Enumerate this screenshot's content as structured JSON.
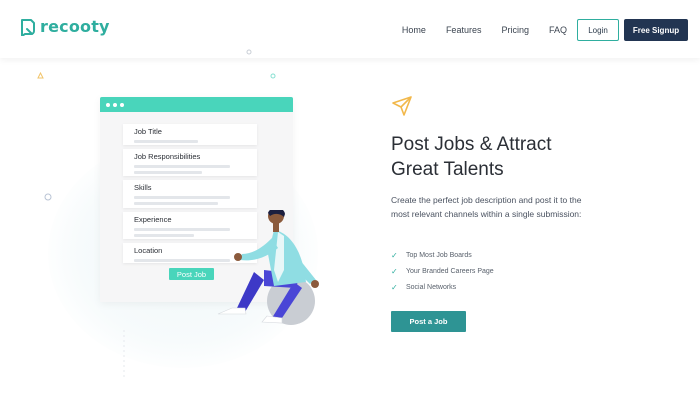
{
  "brand": {
    "name": "recooty",
    "accent": "#2fae9f",
    "dark": "#223552"
  },
  "nav": {
    "links": [
      "Home",
      "Features",
      "Pricing",
      "FAQ"
    ],
    "login_label": "Login",
    "signup_label": "Free Signup"
  },
  "illustration": {
    "fields": [
      "Job Title",
      "Job Responsibilities",
      "Skills",
      "Experience",
      "Location"
    ],
    "post_button_label": "Post Job"
  },
  "hero": {
    "title_line1": "Post Jobs & Attract",
    "title_line2": "Great Talents",
    "description": "Create the perfect job description and post it to the most relevant channels within a single submission:",
    "features": [
      "Top Most Job Boards",
      "Your Branded Careers Page",
      "Social Networks"
    ],
    "cta_label": "Post a Job",
    "cta_color": "#2e9494"
  },
  "icons": [
    "logo-icon",
    "paper-plane-icon",
    "check-icon"
  ]
}
